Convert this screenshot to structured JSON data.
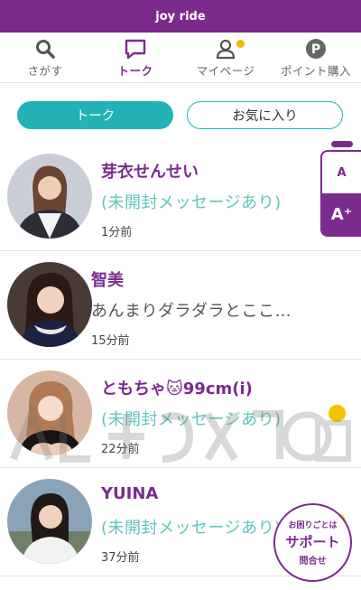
{
  "app": {
    "title": "joy ride"
  },
  "nav": {
    "items": [
      {
        "label": "さがす",
        "icon": "search-icon"
      },
      {
        "label": "トーク",
        "icon": "chat-icon",
        "active": true
      },
      {
        "label": "マイページ",
        "icon": "user-icon",
        "badge": true
      },
      {
        "label": "ポイント購入",
        "icon": "point-icon"
      }
    ]
  },
  "tabs": {
    "talk": "トーク",
    "favorites": "お気に入り"
  },
  "conversations": [
    {
      "name": "芽衣せんせい",
      "message": "(未開封メッセージあり)",
      "time": "1分前",
      "unread": false
    },
    {
      "name": "智美",
      "message": "あんまりダラダラとここ…",
      "time": "15分前",
      "unread": false
    },
    {
      "name": "ともちゃ🐱99cm(i)",
      "message": "(未開封メッセージあり)",
      "time": "22分前",
      "unread": true
    },
    {
      "name": "YUINA",
      "message": "(未開封メッセージあり)",
      "time": "37分前",
      "unread": true
    }
  ],
  "font_size": {
    "small": "A",
    "large": "A⁺"
  },
  "support": {
    "line1": "お困りごとは",
    "line2": "サポート",
    "line3": "問合せ"
  },
  "colors": {
    "brand": "#7b2b8c",
    "accent": "#22b2b8",
    "unread": "#f5c300",
    "message_unread": "#5fc6bd"
  }
}
